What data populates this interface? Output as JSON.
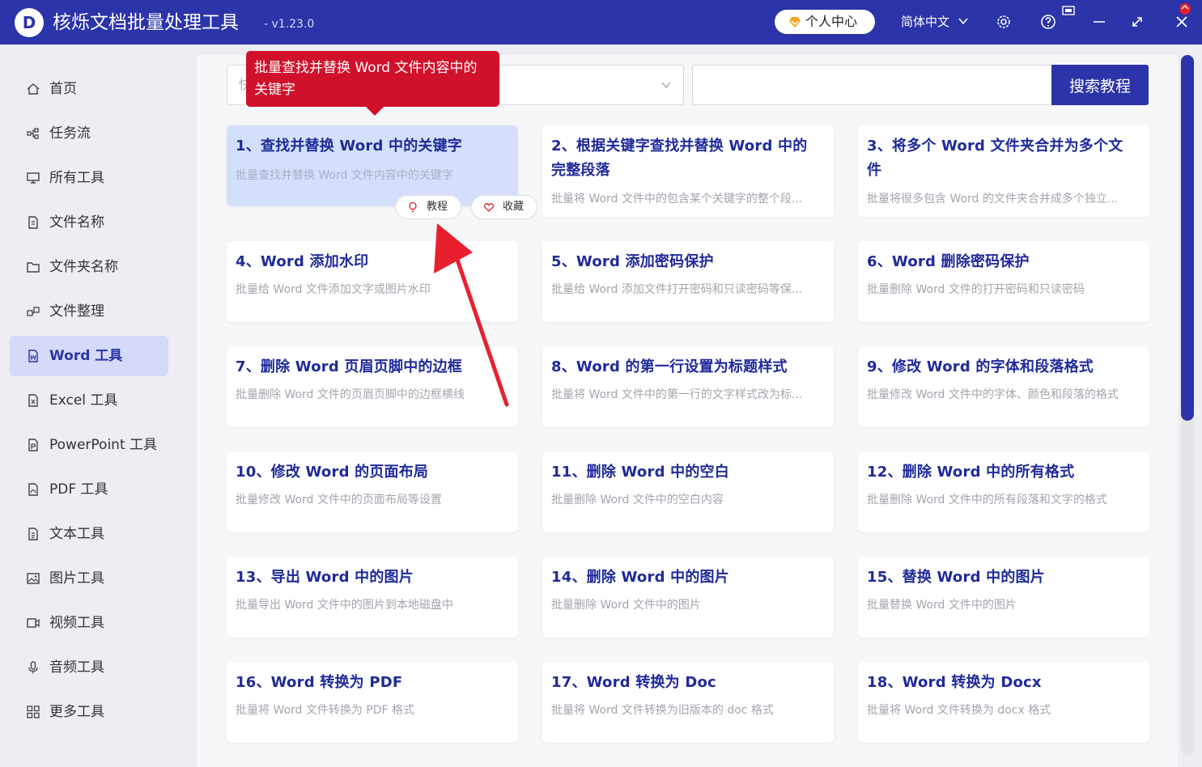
{
  "app": {
    "logo_letter": "D",
    "title": "核烁文档批量处理工具",
    "version": "- v1.23.0"
  },
  "titlebar": {
    "user_center": "个人中心",
    "language": "简体中文",
    "icons": [
      "settings-icon",
      "help-icon",
      "window-mode-icon",
      "resize-icon",
      "close-icon"
    ]
  },
  "sidebar": {
    "items": [
      {
        "label": "首页",
        "icon": "home-icon"
      },
      {
        "label": "任务流",
        "icon": "workflow-icon"
      },
      {
        "label": "所有工具",
        "icon": "monitor-icon"
      },
      {
        "label": "文件名称",
        "icon": "file-name-icon"
      },
      {
        "label": "文件夹名称",
        "icon": "folder-icon"
      },
      {
        "label": "文件整理",
        "icon": "organize-icon"
      },
      {
        "label": "Word 工具",
        "icon": "word-file-icon",
        "active": true
      },
      {
        "label": "Excel 工具",
        "icon": "excel-file-icon"
      },
      {
        "label": "PowerPoint 工具",
        "icon": "ppt-file-icon"
      },
      {
        "label": "PDF 工具",
        "icon": "pdf-file-icon"
      },
      {
        "label": "文本工具",
        "icon": "text-file-icon"
      },
      {
        "label": "图片工具",
        "icon": "image-icon"
      },
      {
        "label": "视频工具",
        "icon": "video-icon"
      },
      {
        "label": "音频工具",
        "icon": "microphone-icon"
      },
      {
        "label": "更多工具",
        "icon": "grid-icon"
      }
    ]
  },
  "search": {
    "select_value": "快",
    "input_value": "",
    "button_label": "搜索教程"
  },
  "tooltip": {
    "text": "批量查找并替换 Word 文件内容中的关键字"
  },
  "card_actions": {
    "tutorial": "教程",
    "favorite": "收藏"
  },
  "cards": [
    {
      "title": "1、查找并替换 Word 中的关键字",
      "desc": "批量查找并替换 Word 文件内容中的关键字"
    },
    {
      "title": "2、根据关键字查找并替换 Word 中的完整段落",
      "desc": "批量将 Word 文件中的包含某个关键字的整个段..."
    },
    {
      "title": "3、将多个 Word 文件夹合并为多个文件",
      "desc": "批量将很多包含 Word 的文件夹合并成多个独立..."
    },
    {
      "title": "4、Word 添加水印",
      "desc": "批量给 Word 文件添加文字或图片水印"
    },
    {
      "title": "5、Word 添加密码保护",
      "desc": "批量给 Word 添加文件打开密码和只读密码等保..."
    },
    {
      "title": "6、Word 删除密码保护",
      "desc": "批量删除 Word 文件的打开密码和只读密码"
    },
    {
      "title": "7、删除 Word 页眉页脚中的边框",
      "desc": "批量删除 Word 文件的页眉页脚中的边框横线"
    },
    {
      "title": "8、Word 的第一行设置为标题样式",
      "desc": "批量将 Word 文件中的第一行的文字样式改为标..."
    },
    {
      "title": "9、修改 Word 的字体和段落格式",
      "desc": "批量修改 Word 文件中的字体、颜色和段落的格式"
    },
    {
      "title": "10、修改 Word 的页面布局",
      "desc": "批量修改 Word 文件中的页面布局等设置"
    },
    {
      "title": "11、删除 Word 中的空白",
      "desc": "批量删除 Word 文件中的空白内容"
    },
    {
      "title": "12、删除 Word 中的所有格式",
      "desc": "批量删除 Word 文件中的所有段落和文字的格式"
    },
    {
      "title": "13、导出 Word 中的图片",
      "desc": "批量导出 Word 文件中的图片到本地磁盘中"
    },
    {
      "title": "14、删除 Word 中的图片",
      "desc": "批量删除 Word 文件中的图片"
    },
    {
      "title": "15、替换 Word 中的图片",
      "desc": "批量替换 Word 文件中的图片"
    },
    {
      "title": "16、Word 转换为 PDF",
      "desc": "批量将 Word 文件转换为 PDF 格式"
    },
    {
      "title": "17、Word 转换为 Doc",
      "desc": "批量将 Word 文件转换为旧版本的 doc 格式"
    },
    {
      "title": "18、Word 转换为 Docx",
      "desc": "批量将 Word 文件转换为 docx 格式"
    }
  ],
  "colors": {
    "brand": "#2b34a8",
    "tooltip": "#d0112b",
    "active_card": "#d4e0fb",
    "active_nav": "#d4daf7"
  }
}
